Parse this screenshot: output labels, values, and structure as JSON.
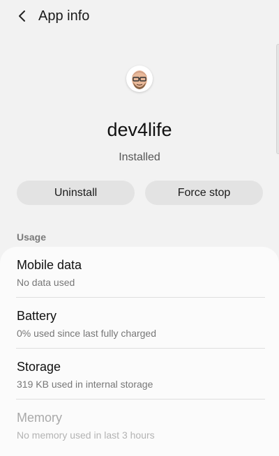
{
  "header": {
    "back_icon": "back-arrow-icon",
    "title": "App info"
  },
  "app": {
    "icon": "avatar-face-icon",
    "name": "dev4life",
    "status": "Installed"
  },
  "actions": {
    "uninstall_label": "Uninstall",
    "force_stop_label": "Force stop"
  },
  "usage": {
    "section_label": "Usage",
    "items": [
      {
        "title": "Mobile data",
        "subtitle": "No data used",
        "enabled": true
      },
      {
        "title": "Battery",
        "subtitle": "0% used since last fully charged",
        "enabled": true
      },
      {
        "title": "Storage",
        "subtitle": "319 KB used in internal storage",
        "enabled": true
      },
      {
        "title": "Memory",
        "subtitle": "No memory used in last 3 hours",
        "enabled": false
      }
    ]
  },
  "colors": {
    "background": "#f2f2f2",
    "card": "#fbfbfb",
    "pill_button": "#e3e3e3",
    "section_label": "#7a7a7a",
    "disabled_text": "#a9a9a9"
  }
}
